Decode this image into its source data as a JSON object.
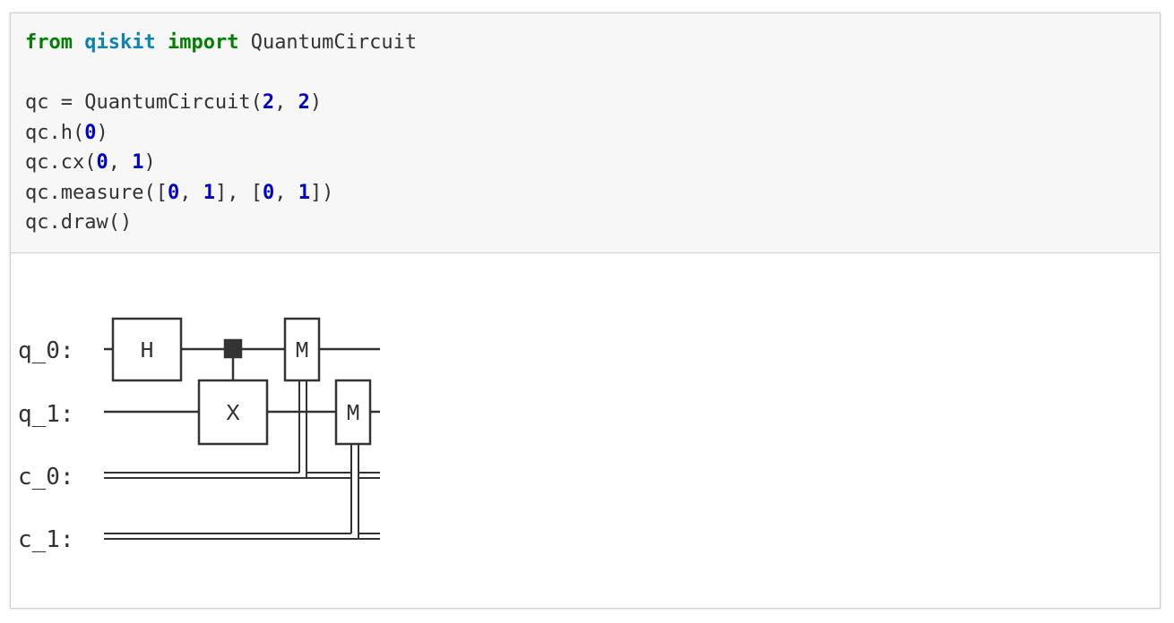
{
  "code_cell": {
    "lines": [
      [
        {
          "text": "from",
          "kind": "kw"
        },
        {
          "text": " ",
          "kind": "plain"
        },
        {
          "text": "qiskit",
          "kind": "mod"
        },
        {
          "text": " ",
          "kind": "plain"
        },
        {
          "text": "import",
          "kind": "kw"
        },
        {
          "text": " QuantumCircuit",
          "kind": "plain"
        }
      ],
      [],
      [
        {
          "text": "qc = QuantumCircuit(",
          "kind": "plain"
        },
        {
          "text": "2",
          "kind": "num"
        },
        {
          "text": ", ",
          "kind": "plain"
        },
        {
          "text": "2",
          "kind": "num"
        },
        {
          "text": ")",
          "kind": "plain"
        }
      ],
      [
        {
          "text": "qc.h(",
          "kind": "plain"
        },
        {
          "text": "0",
          "kind": "num"
        },
        {
          "text": ")",
          "kind": "plain"
        }
      ],
      [
        {
          "text": "qc.cx(",
          "kind": "plain"
        },
        {
          "text": "0",
          "kind": "num"
        },
        {
          "text": ", ",
          "kind": "plain"
        },
        {
          "text": "1",
          "kind": "num"
        },
        {
          "text": ")",
          "kind": "plain"
        }
      ],
      [
        {
          "text": "qc.measure([",
          "kind": "plain"
        },
        {
          "text": "0",
          "kind": "num"
        },
        {
          "text": ", ",
          "kind": "plain"
        },
        {
          "text": "1",
          "kind": "num"
        },
        {
          "text": "], [",
          "kind": "plain"
        },
        {
          "text": "0",
          "kind": "num"
        },
        {
          "text": ", ",
          "kind": "plain"
        },
        {
          "text": "1",
          "kind": "num"
        },
        {
          "text": "])",
          "kind": "plain"
        }
      ],
      [
        {
          "text": "qc.draw()",
          "kind": "plain"
        }
      ]
    ]
  },
  "output": {
    "wire_labels": {
      "q0": "q_0:",
      "q1": "q_1:",
      "c0": "c_0:",
      "c1": "c_1:"
    },
    "gates": {
      "h": "H",
      "x": "X",
      "m0": "M",
      "m1": "M"
    }
  },
  "colors": {
    "code_bg": "#f7f7f7",
    "keyword": "#008000",
    "module": "#0e84b5",
    "number": "#0000cc",
    "text": "#333333",
    "border": "#cfcfcf"
  }
}
